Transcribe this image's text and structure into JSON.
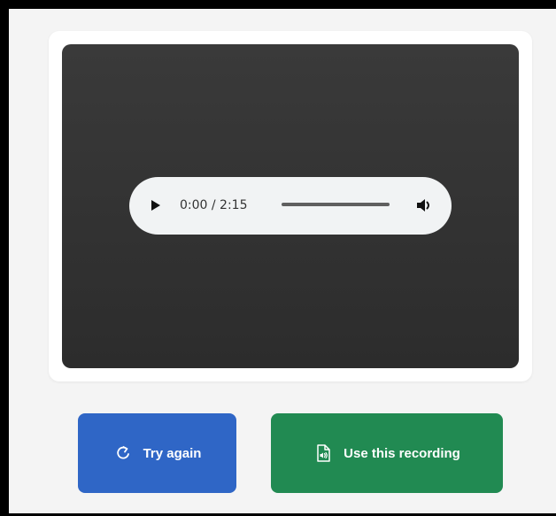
{
  "player": {
    "current_time": "0:00",
    "duration": "2:15",
    "time_display": "0:00 / 2:15",
    "progress_fraction": 0,
    "icons": {
      "play": "play-icon",
      "volume": "volume-icon"
    }
  },
  "actions": {
    "try_again_label": "Try again",
    "try_again_icon": "redo-icon",
    "use_recording_label": "Use this recording",
    "use_recording_icon": "audio-file-icon"
  },
  "colors": {
    "try_again_bg": "#2f66c6",
    "use_recording_bg": "#218a52",
    "player_panel_bg": "#333333",
    "audio_bar_bg": "#f1f3f4"
  }
}
